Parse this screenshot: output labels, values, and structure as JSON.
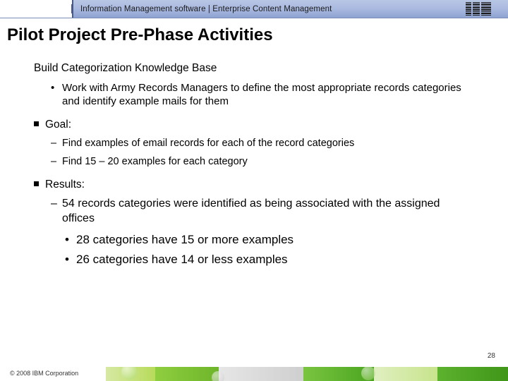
{
  "header": {
    "breadcrumb": "Information Management software | Enterprise Content Management",
    "logo_label": "IBM"
  },
  "title": "Pilot Project Pre-Phase Activities",
  "body": {
    "section_head": "Build Categorization Knowledge Base",
    "bullet1": "Work with Army Records Managers to define the most appropriate records categories and identify example mails for them",
    "goal_label": "Goal:",
    "goal_items": {
      "g1": "Find examples of email records for each of the record categories",
      "g2": "Find 15 – 20 examples for each category"
    },
    "results_label": "Results:",
    "results_items": {
      "r1": "54 records categories were identified as being associated with the assigned offices",
      "r1_sub1": "28 categories have 15 or more examples",
      "r1_sub2": "26 categories have 14 or less examples"
    }
  },
  "footer": {
    "page_number": "28",
    "copyright": "© 2008 IBM Corporation"
  }
}
